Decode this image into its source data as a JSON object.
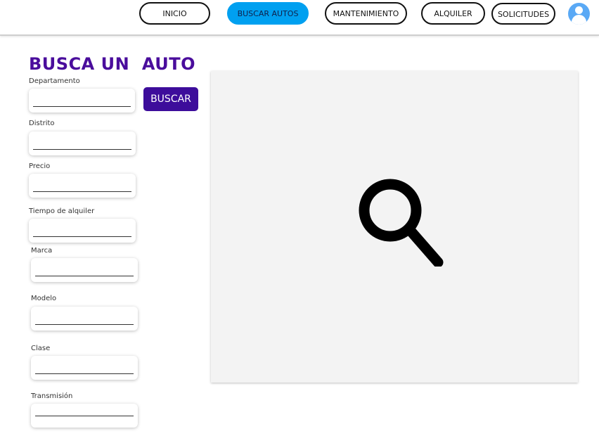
{
  "nav": {
    "items": [
      {
        "label": "INICIO",
        "active": false
      },
      {
        "label": "BUSCAR AUTOS",
        "active": true
      },
      {
        "label": "MANTENIMIENTO",
        "active": false
      },
      {
        "label": "ALQUILER",
        "active": false
      },
      {
        "label": "SOLICITUDES",
        "active": false
      }
    ],
    "avatar_icon": "user-avatar-icon"
  },
  "title": "BUSCA UN  AUTO",
  "search_button": "BUSCAR",
  "fields": [
    {
      "label": "Departamento",
      "value": ""
    },
    {
      "label": "Distrito",
      "value": ""
    },
    {
      "label": "Precio",
      "value": ""
    },
    {
      "label": "Tiempo de alquiler",
      "value": ""
    },
    {
      "label": "Marca",
      "value": ""
    },
    {
      "label": "Modelo",
      "value": ""
    },
    {
      "label": "Clase",
      "value": ""
    },
    {
      "label": "Transmisión",
      "value": ""
    }
  ],
  "results": {
    "icon": "magnifier-icon"
  },
  "colors": {
    "accent": "#00a0f0",
    "brand": "#4a0d9c",
    "button": "#3d0d9b"
  }
}
